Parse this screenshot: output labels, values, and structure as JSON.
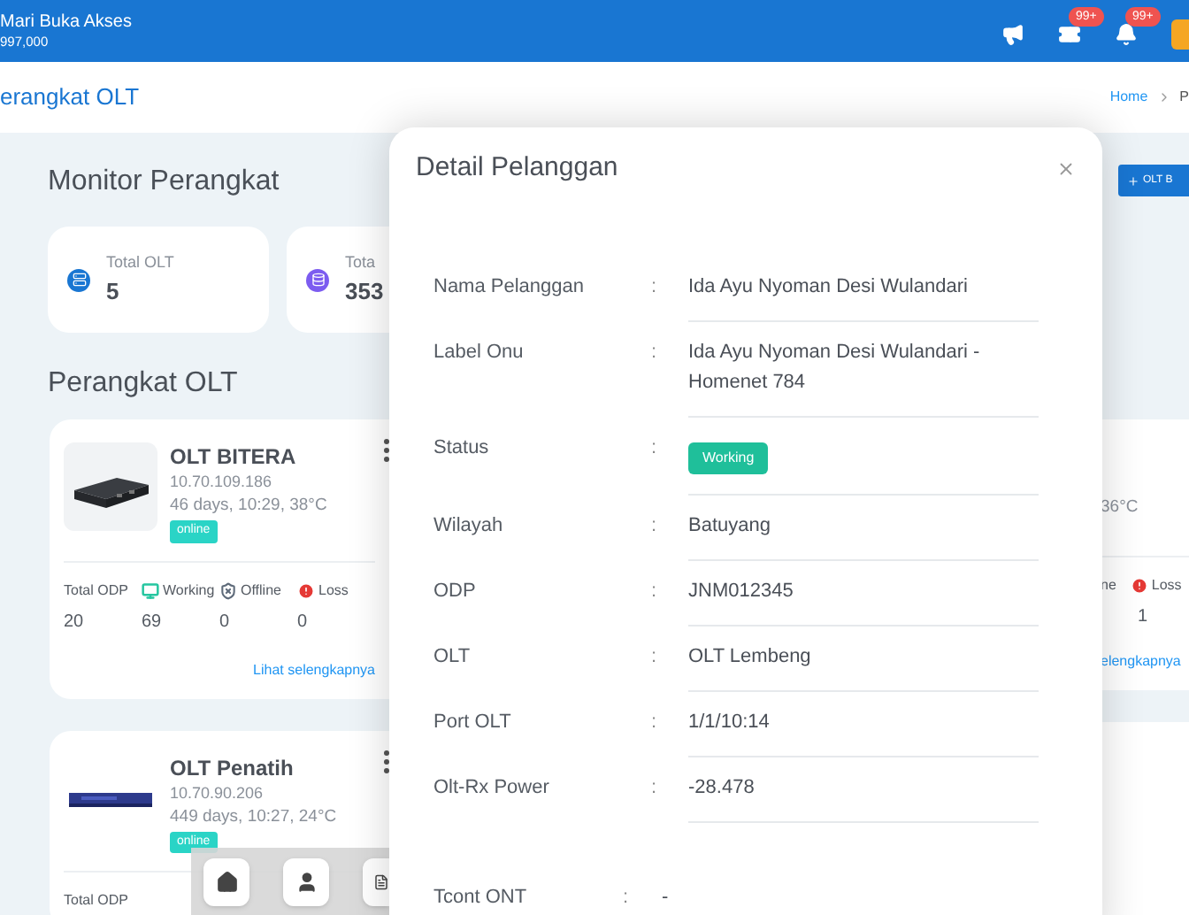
{
  "header": {
    "title": "Mari Buka Akses",
    "subtitle": "997,000",
    "icons": [
      {
        "kind": "announcement"
      },
      {
        "kind": "ticket",
        "badge": "99+"
      },
      {
        "kind": "bell",
        "badge": "99+"
      }
    ]
  },
  "page": {
    "title": "erangkat OLT",
    "breadcrumb": [
      "Home",
      "P"
    ]
  },
  "monitor": {
    "heading": "Monitor Perangkat",
    "add_button": "OLT B",
    "stats": [
      {
        "kind": "server",
        "label": "Total OLT",
        "value": "5"
      },
      {
        "kind": "database",
        "label": "Tota",
        "value": "353"
      }
    ]
  },
  "devices": {
    "heading": "Perangkat OLT",
    "cards": [
      {
        "name": "OLT BITERA",
        "ip": "10.70.109.186",
        "uptime": "46 days, 10:29, 38°C",
        "status": "online",
        "link": "Lihat selengkapnya",
        "stats": [
          {
            "kind": "total",
            "label": "Total ODP",
            "value": "20"
          },
          {
            "kind": "working",
            "label": "Working",
            "value": "69"
          },
          {
            "kind": "offline",
            "label": "Offline",
            "value": "0"
          },
          {
            "kind": "loss",
            "label": "Loss",
            "value": "0"
          }
        ]
      },
      {
        "name": "OLT Penatih",
        "ip": "10.70.90.206",
        "uptime": "449 days, 10:27, 24°C",
        "status": "online",
        "stats": [
          {
            "kind": "total",
            "label": "Total ODP"
          }
        ]
      }
    ],
    "side_card": {
      "uptime": "36°C",
      "stat_label": "ne",
      "loss_label": "Loss",
      "value": "1",
      "link": "elengkapnya"
    }
  },
  "modal": {
    "title": "Detail Pelanggan",
    "rows": [
      {
        "kind": "text",
        "label": "Nama Pelanggan",
        "separator": ":",
        "value": "Ida Ayu Nyoman Desi Wulandari"
      },
      {
        "kind": "text",
        "label": "Label Onu",
        "separator": ":",
        "value": "Ida Ayu Nyoman Desi Wulandari - Homenet 784"
      },
      {
        "kind": "badge",
        "label": "Status",
        "separator": ":",
        "value": "Working"
      },
      {
        "kind": "text",
        "label": "Wilayah",
        "separator": ":",
        "value": "Batuyang"
      },
      {
        "kind": "text",
        "label": "ODP",
        "separator": ":",
        "value": "JNM012345"
      },
      {
        "kind": "text",
        "label": "OLT",
        "separator": ":",
        "value": "OLT Lembeng"
      },
      {
        "kind": "text",
        "label": "Port OLT",
        "separator": ":",
        "value": "1/1/10:14"
      },
      {
        "kind": "text",
        "label": "Olt-Rx Power",
        "separator": ":",
        "value": "-28.478"
      }
    ],
    "extra": {
      "label": "Tcont ONT",
      "separator": ":",
      "value": "-"
    }
  },
  "bottom_nav": [
    {
      "kind": "home"
    },
    {
      "kind": "user"
    },
    {
      "kind": "document"
    }
  ]
}
